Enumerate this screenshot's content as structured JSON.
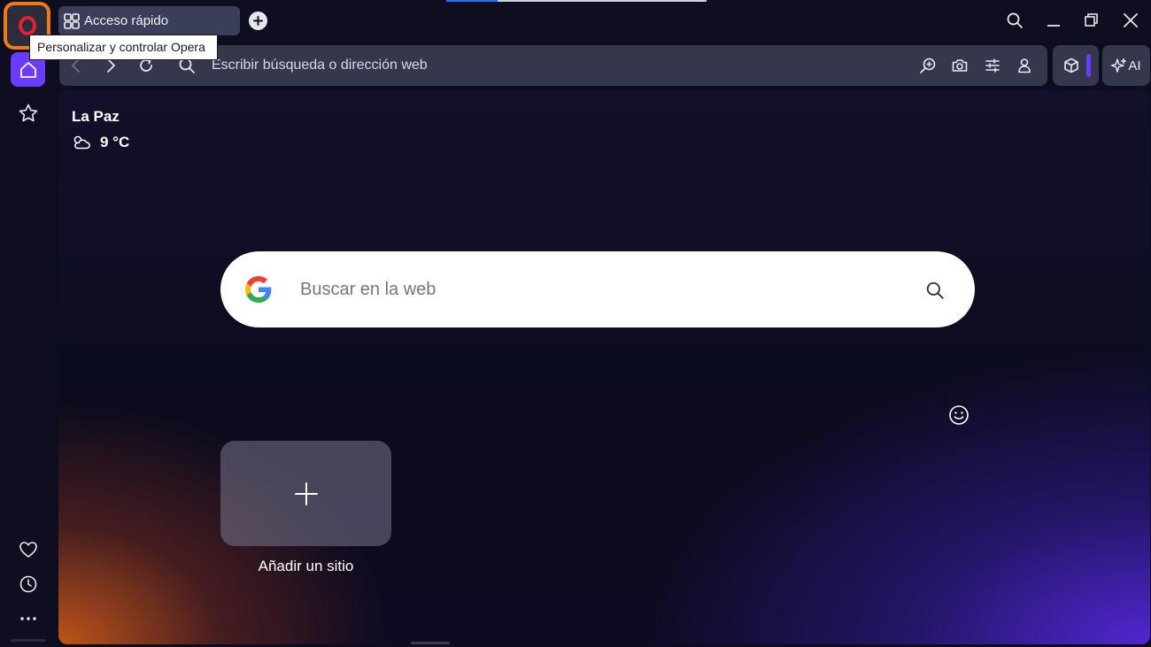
{
  "window": {
    "tooltip": "Personalizar y controlar Opera"
  },
  "tabs": [
    {
      "title": "Acceso rápido",
      "icon": "grid-icon"
    }
  ],
  "address_bar": {
    "placeholder": "Escribir búsqueda o dirección web"
  },
  "toolbar": {
    "ai_label": "AI"
  },
  "weather": {
    "city": "La Paz",
    "temperature": "9 °C",
    "icon": "partly-cloudy-icon"
  },
  "search": {
    "placeholder": "Buscar en la web",
    "engine": "google-logo"
  },
  "speed_dial": {
    "add_site_label": "Añadir un sitio"
  },
  "colors": {
    "accent": "#6a3cff",
    "highlight": "#f07a1a",
    "opera_red": "#e8202e"
  }
}
